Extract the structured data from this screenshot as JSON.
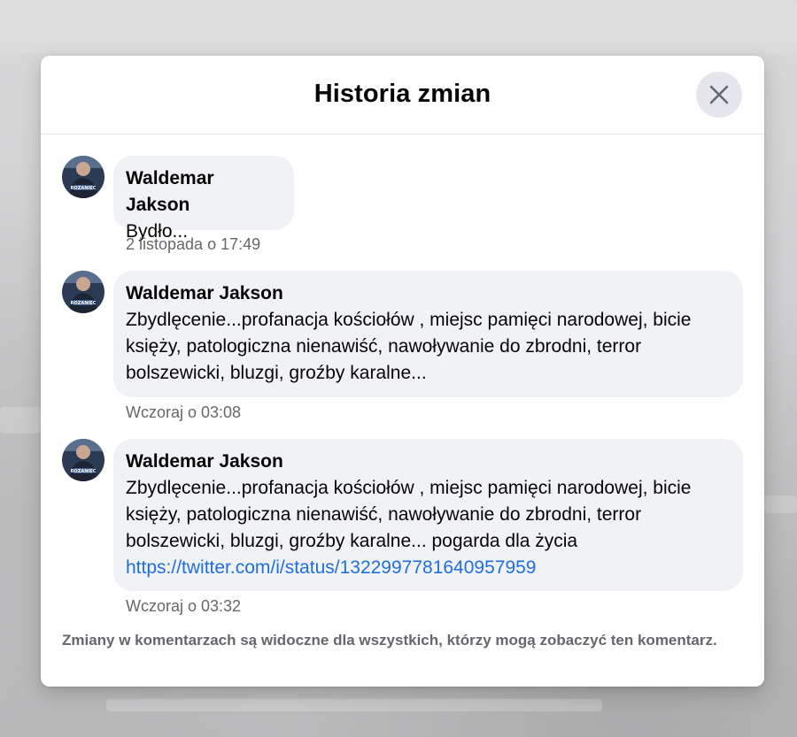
{
  "dialog": {
    "title": "Historia zmian",
    "close_icon": "close-icon"
  },
  "comments": [
    {
      "author": "Waldemar Jakson",
      "text": "Bydło...",
      "link": "",
      "timestamp": "2 listopada o 17:49"
    },
    {
      "author": "Waldemar Jakson",
      "text": "Zbydlęcenie...profanacja kościołów , miejsc pamięci narodowej, bicie księży, patologiczna nienawiść, nawoływanie do zbrodni, terror bolszewicki, bluzgi, groźby karalne...",
      "link": "",
      "timestamp": "Wczoraj o 03:08"
    },
    {
      "author": "Waldemar Jakson",
      "text": "Zbydlęcenie...profanacja kościołów , miejsc pamięci narodowej, bicie księży, patologiczna nienawiść, nawoływanie do zbrodni, terror bolszewicki, bluzgi, groźby karalne... pogarda dla życia",
      "link": "https://twitter.com/i/status/1322997781640957959",
      "timestamp": "Wczoraj o 03:32"
    }
  ],
  "footer": {
    "note": "Zmiany w komentarzach są widoczne dla wszystkich, którzy mogą zobaczyć ten komentarz."
  },
  "colors": {
    "bubble_bg": "#f0f2f5",
    "link": "#216fdb",
    "secondary_text": "#65676b",
    "close_button_bg": "#e4e6eb"
  }
}
